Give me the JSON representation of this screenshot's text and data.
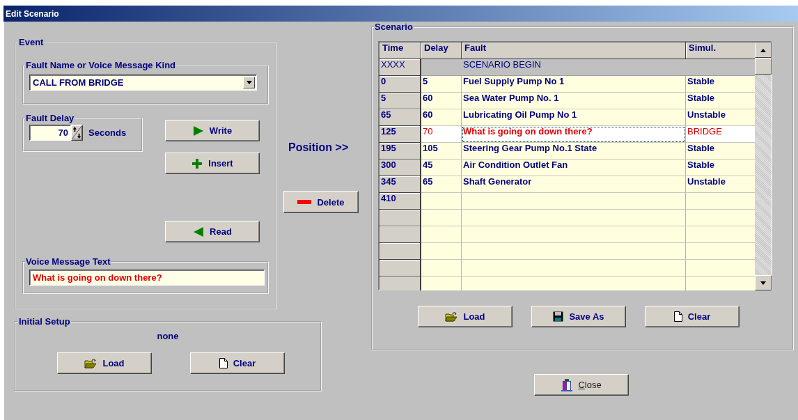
{
  "window": {
    "title": "Edit Scenario"
  },
  "event": {
    "title": "Event",
    "fault_name": {
      "title": "Fault Name or Voice Message Kind",
      "value": "CALL FROM BRIDGE"
    },
    "fault_delay": {
      "title": "Fault Delay",
      "value": "70",
      "unit": "Seconds"
    },
    "buttons": [
      {
        "label": "Write",
        "kind": "write"
      },
      {
        "label": "Insert",
        "kind": "insert"
      },
      {
        "label": "Read",
        "kind": "read"
      }
    ],
    "voice_message": {
      "title": "Voice Message Text",
      "value": "What is going on down there?"
    }
  },
  "position_label": "Position >>",
  "delete_button": {
    "label": "Delete",
    "kind": "delete"
  },
  "initial_setup": {
    "title": "Initial Setup",
    "value": "none",
    "buttons": [
      {
        "label": "Load",
        "kind": "load"
      },
      {
        "label": "Clear",
        "kind": "clear"
      }
    ]
  },
  "scenario": {
    "title": "Scenario",
    "columns": [
      "Time",
      "Delay",
      "Fault",
      "Simul."
    ],
    "rows": [
      {
        "kind": "begin",
        "time": "XXXX",
        "fault": "SCENARIO BEGIN",
        "selected": false
      },
      {
        "kind": "event",
        "time": "0",
        "delay": "5",
        "fault": "Fuel Supply Pump No 1",
        "simul": "Stable",
        "selected": false
      },
      {
        "kind": "event",
        "time": "5",
        "delay": "60",
        "fault": "Sea Water Pump No. 1",
        "simul": "Stable",
        "selected": false
      },
      {
        "kind": "event",
        "time": "65",
        "delay": "60",
        "fault": "Lubricating Oil Pump No 1",
        "simul": "Unstable",
        "selected": false
      },
      {
        "kind": "event",
        "time": "125",
        "delay": "70",
        "fault": "What is going on down there?",
        "simul": "BRIDGE",
        "selected": true
      },
      {
        "kind": "event",
        "time": "195",
        "delay": "105",
        "fault": "Steering Gear Pump No.1 State",
        "simul": "Stable",
        "selected": false
      },
      {
        "kind": "event",
        "time": "300",
        "delay": "45",
        "fault": "Air Condition Outlet Fan",
        "simul": "Stable",
        "selected": false
      },
      {
        "kind": "event",
        "time": "345",
        "delay": "65",
        "fault": "Shaft Generator",
        "simul": "Unstable",
        "selected": false
      },
      {
        "kind": "event",
        "time": "410",
        "selected": false
      }
    ],
    "buttons": [
      {
        "label": "Load",
        "kind": "load"
      },
      {
        "label": "Save As",
        "kind": "save"
      },
      {
        "label": "Clear",
        "kind": "clear"
      }
    ]
  },
  "close_button": {
    "label": "Close",
    "kind": "close"
  }
}
